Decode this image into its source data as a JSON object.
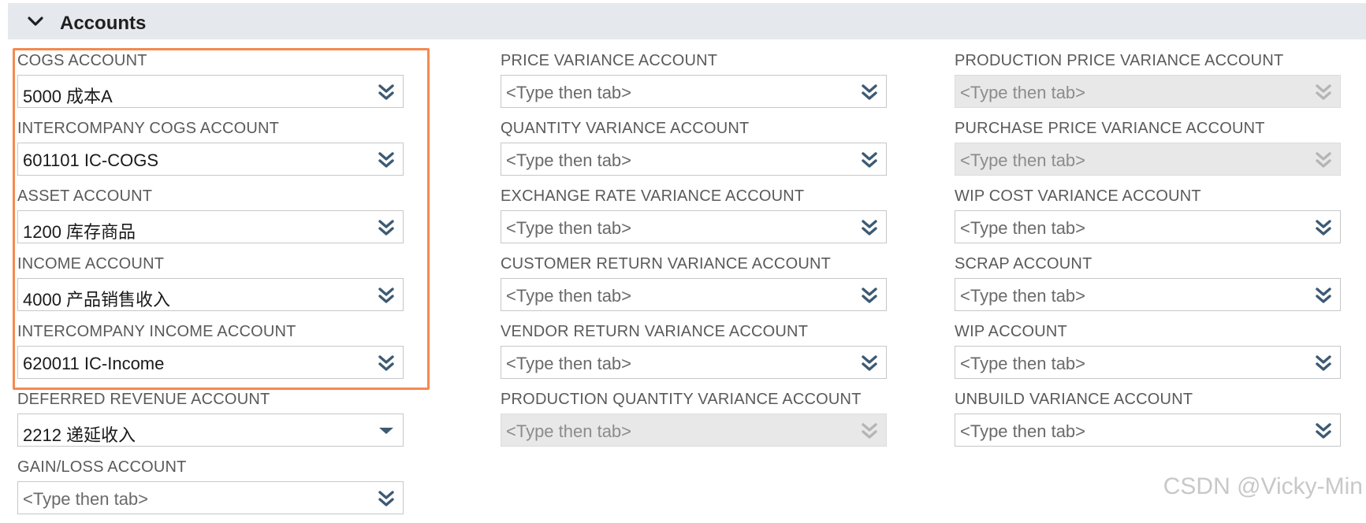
{
  "section": {
    "title": "Accounts",
    "collapse_icon": "chevron-down-icon"
  },
  "colors": {
    "highlight": "#f5894f",
    "icon": "#3d5a73",
    "disabled_icon": "#b5b5b5",
    "header_bg": "#e5e8ec"
  },
  "columns": [
    {
      "fields": [
        {
          "label": "COGS ACCOUNT",
          "value": "5000 成本A",
          "placeholder": false,
          "disabled": false,
          "icon": "double-chevron-down-icon"
        },
        {
          "label": "INTERCOMPANY COGS ACCOUNT",
          "value": "601101 IC-COGS",
          "placeholder": false,
          "disabled": false,
          "icon": "double-chevron-down-icon"
        },
        {
          "label": "ASSET ACCOUNT",
          "value": "1200 库存商品",
          "placeholder": false,
          "disabled": false,
          "icon": "double-chevron-down-icon"
        },
        {
          "label": "INCOME ACCOUNT",
          "value": "4000 产品销售收入",
          "placeholder": false,
          "disabled": false,
          "icon": "double-chevron-down-icon"
        },
        {
          "label": "INTERCOMPANY INCOME ACCOUNT",
          "value": "620011 IC-Income",
          "placeholder": false,
          "disabled": false,
          "icon": "double-chevron-down-icon"
        },
        {
          "label": "DEFERRED REVENUE ACCOUNT",
          "value": "2212 递延收入",
          "placeholder": false,
          "disabled": false,
          "icon": "caret-down-icon"
        },
        {
          "label": "GAIN/LOSS ACCOUNT",
          "value": "<Type then tab>",
          "placeholder": true,
          "disabled": false,
          "icon": "double-chevron-down-icon"
        }
      ]
    },
    {
      "fields": [
        {
          "label": "PRICE VARIANCE ACCOUNT",
          "value": "<Type then tab>",
          "placeholder": true,
          "disabled": false,
          "icon": "double-chevron-down-icon"
        },
        {
          "label": "QUANTITY VARIANCE ACCOUNT",
          "value": "<Type then tab>",
          "placeholder": true,
          "disabled": false,
          "icon": "double-chevron-down-icon"
        },
        {
          "label": "EXCHANGE RATE VARIANCE ACCOUNT",
          "value": "<Type then tab>",
          "placeholder": true,
          "disabled": false,
          "icon": "double-chevron-down-icon"
        },
        {
          "label": "CUSTOMER RETURN VARIANCE ACCOUNT",
          "value": "<Type then tab>",
          "placeholder": true,
          "disabled": false,
          "icon": "double-chevron-down-icon"
        },
        {
          "label": "VENDOR RETURN VARIANCE ACCOUNT",
          "value": "<Type then tab>",
          "placeholder": true,
          "disabled": false,
          "icon": "double-chevron-down-icon"
        },
        {
          "label": "PRODUCTION QUANTITY VARIANCE ACCOUNT",
          "value": "<Type then tab>",
          "placeholder": true,
          "disabled": true,
          "icon": "double-chevron-down-icon"
        }
      ]
    },
    {
      "fields": [
        {
          "label": "PRODUCTION PRICE VARIANCE ACCOUNT",
          "value": "<Type then tab>",
          "placeholder": true,
          "disabled": true,
          "icon": "double-chevron-down-icon"
        },
        {
          "label": "PURCHASE PRICE VARIANCE ACCOUNT",
          "value": "<Type then tab>",
          "placeholder": true,
          "disabled": true,
          "icon": "double-chevron-down-icon"
        },
        {
          "label": "WIP COST VARIANCE ACCOUNT",
          "value": "<Type then tab>",
          "placeholder": true,
          "disabled": false,
          "icon": "double-chevron-down-icon"
        },
        {
          "label": "SCRAP ACCOUNT",
          "value": "<Type then tab>",
          "placeholder": true,
          "disabled": false,
          "icon": "double-chevron-down-icon"
        },
        {
          "label": "WIP ACCOUNT",
          "value": "<Type then tab>",
          "placeholder": true,
          "disabled": false,
          "icon": "double-chevron-down-icon"
        },
        {
          "label": "UNBUILD VARIANCE ACCOUNT",
          "value": "<Type then tab>",
          "placeholder": true,
          "disabled": false,
          "icon": "double-chevron-down-icon"
        }
      ]
    }
  ],
  "watermark": "CSDN @Vicky-Min"
}
